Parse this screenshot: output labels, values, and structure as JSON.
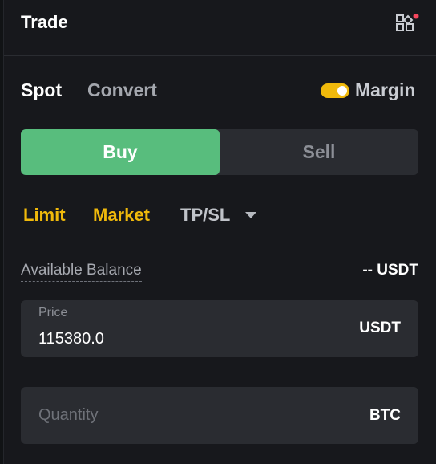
{
  "header": {
    "title": "Trade",
    "icon": "apps-grid-icon",
    "notification_dot_color": "#f6465d"
  },
  "mode_tabs": {
    "spot": "Spot",
    "convert": "Convert",
    "margin_label": "Margin",
    "margin_enabled": true
  },
  "side": {
    "buy": "Buy",
    "sell": "Sell",
    "selected": "Buy"
  },
  "order_types": {
    "limit": "Limit",
    "market": "Market",
    "tpsl": "TP/SL"
  },
  "balance": {
    "label": "Available Balance",
    "value": "-- USDT"
  },
  "price_field": {
    "label": "Price",
    "value": "115380.0",
    "unit": "USDT"
  },
  "quantity_field": {
    "placeholder": "Quantity",
    "unit": "BTC"
  },
  "colors": {
    "accent_yellow": "#f0b90b",
    "buy_green": "#58bd7d",
    "panel_bg": "#17181c",
    "field_bg": "#2a2c31"
  }
}
